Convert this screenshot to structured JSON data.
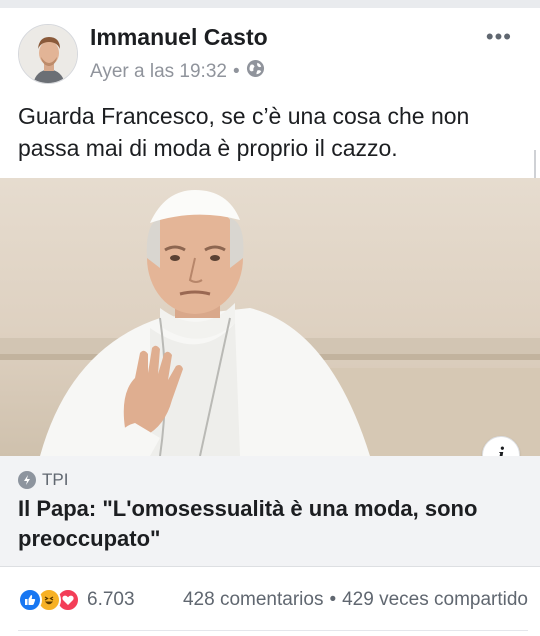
{
  "post": {
    "author": "Immanuel Casto",
    "timestamp": "Ayer a las 19:32",
    "separator": "•",
    "privacy_icon": "globe-icon",
    "more_icon": "more-dots-icon",
    "more_label": "•••",
    "text": "Guarda Francesco, se c’è una cosa che non passa mai di moda è proprio il cazzo."
  },
  "link_preview": {
    "source": "TPI",
    "source_icon": "bolt-icon",
    "title": "Il Papa: \"L'omosessualità è una moda, sono preoccupato\"",
    "info_label": "i"
  },
  "engagement": {
    "reactions": [
      "like-icon",
      "haha-icon",
      "love-icon"
    ],
    "reaction_count": "6.703",
    "comments": "428 comentarios",
    "dot": "•",
    "shares": "429 veces compartido"
  },
  "colors": {
    "like": "#1877f2",
    "haha": "#f7b125",
    "love": "#f33e58",
    "caption_bg": "#f2f3f5",
    "meta_text": "#90949c"
  }
}
